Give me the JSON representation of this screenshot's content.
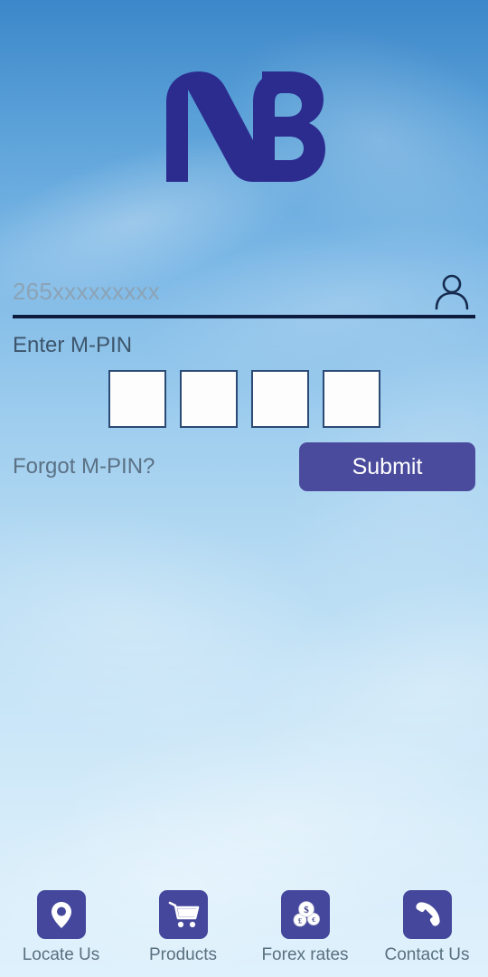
{
  "brand": {
    "logo_name": "nb-monogram-logo",
    "logo_color": "#2c2c8f",
    "accent_color": "#4b4b9e",
    "nav_tile_color": "#44479b",
    "underline_color": "#0d1b3e"
  },
  "background": {
    "type": "sky-photo-gradient",
    "top_color": "#3c87c9",
    "bottom_color": "#dff1fc"
  },
  "login": {
    "phone": {
      "placeholder": "265xxxxxxxxx",
      "value": "",
      "icon": "user-icon"
    },
    "mpin_label": "Enter M-PIN",
    "pin_digits": [
      "",
      "",
      "",
      ""
    ],
    "forgot_label": "Forgot M-PIN?",
    "submit_label": "Submit"
  },
  "bottom_nav": {
    "items": [
      {
        "label": "Locate Us",
        "icon": "map-pin-icon"
      },
      {
        "label": "Products",
        "icon": "shopping-cart-icon"
      },
      {
        "label": "Forex rates",
        "icon": "coins-icon"
      },
      {
        "label": "Contact Us",
        "icon": "phone-icon"
      }
    ]
  }
}
